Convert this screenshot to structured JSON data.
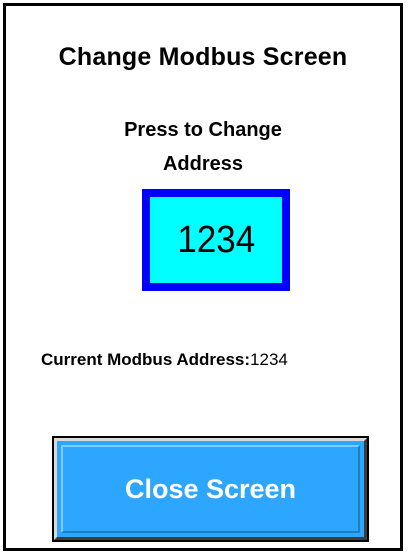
{
  "screen": {
    "title": "Change Modbus Screen",
    "instruction_line1": "Press to Change",
    "instruction_line2": "Address"
  },
  "address_button": {
    "value": "1234",
    "fill_color": "#00ffff",
    "border_color": "#0000ff"
  },
  "current_address": {
    "label": "Current Modbus Address:",
    "value": "1234"
  },
  "close_button": {
    "label": "Close Screen",
    "color": "#2da6ff"
  }
}
